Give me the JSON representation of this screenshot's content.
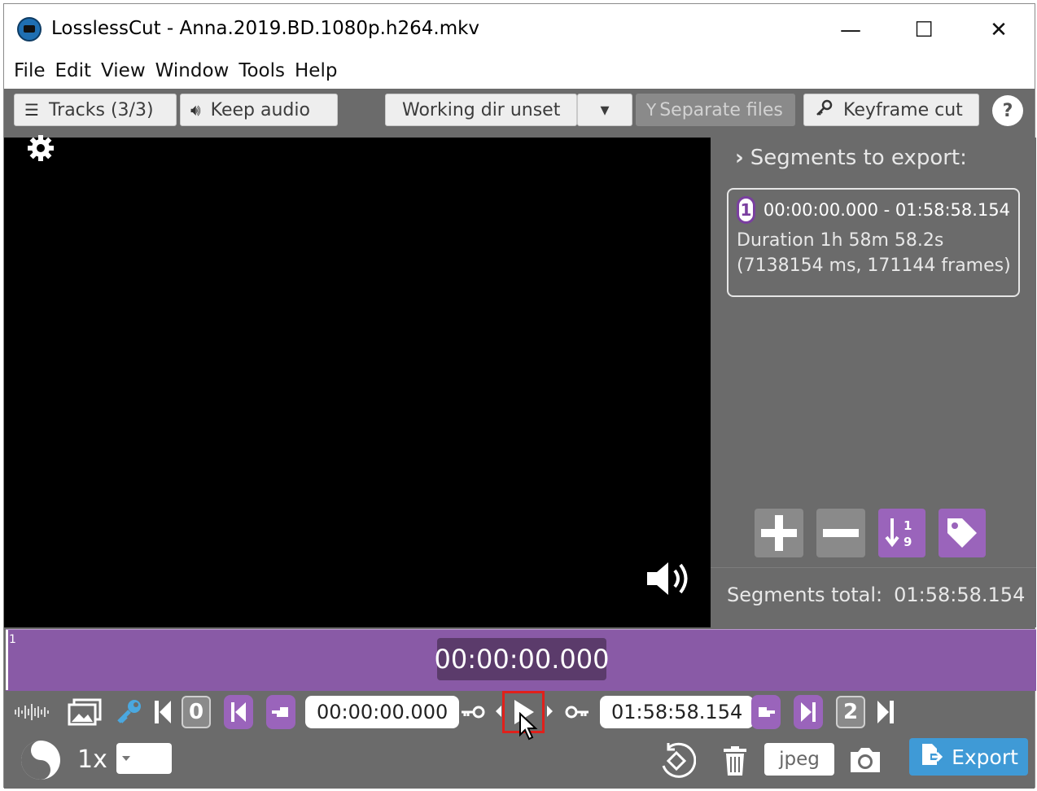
{
  "window": {
    "title": "LosslessCut - Anna.2019.BD.1080p.h264.mkv",
    "controls": {
      "minimize": "—",
      "maximize": "☐",
      "close": "✕"
    }
  },
  "menu": [
    "File",
    "Edit",
    "View",
    "Window",
    "Tools",
    "Help"
  ],
  "toolbar": {
    "tracks_label": "Tracks (3/3)",
    "keep_audio_label": "Keep audio",
    "working_dir_label": "Working dir unset",
    "working_dir_dropdown": "▾",
    "separate_files_label": "Separate files",
    "keyframe_cut_label": "Keyframe cut",
    "help_label": "?"
  },
  "segments": {
    "heading": "Segments to export:",
    "items": [
      {
        "number": "1",
        "range": "00:00:00.000 - 01:58:58.154",
        "duration": "Duration 1h 58m 58.2s",
        "detail": "(7138154 ms, 171144 frames)"
      }
    ],
    "total_label": "Segments total:",
    "total_value": "01:58:58.154"
  },
  "timeline": {
    "segment_marker": "1",
    "current_time": "00:00:00.000"
  },
  "controls": {
    "start_time": "00:00:00.000",
    "end_time": "01:58:58.154",
    "cut_start_index": "0",
    "cut_end_index": "2",
    "speed": "1x",
    "capture_format": "jpeg",
    "export_label": "Export"
  },
  "colors": {
    "purple_accent": "#9a64bb",
    "timeline": "#895aa6",
    "panel_bg": "#6b6b6b",
    "export_blue": "#3f9ad6",
    "highlight_red": "#e0201b"
  },
  "icons": [
    "gear-icon",
    "volume-icon",
    "add-segment-icon",
    "remove-segment-icon",
    "sort-segments-icon",
    "tag-icon",
    "waveform-icon",
    "thumbnails-icon",
    "key-icon",
    "play-icon",
    "cursor-icon",
    "yin-yang-icon",
    "rotate-icon",
    "trash-icon",
    "camera-icon"
  ]
}
